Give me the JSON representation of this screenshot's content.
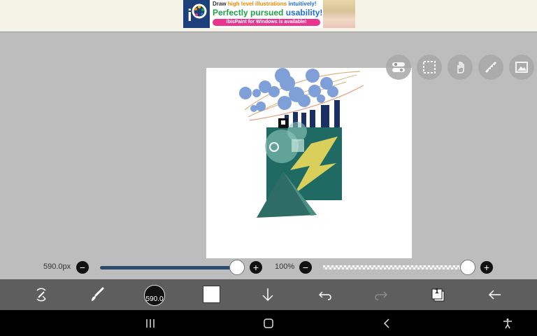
{
  "ad": {
    "line1_a": "Draw ",
    "line1_b": "high level illustrations",
    "line1_c": " intuitively!",
    "line2_a": "Perfectly pursued ",
    "line2_b": "usability!",
    "line3": "ibisPaint for Windows is available!",
    "logo_icon": "ibispaint-logo-icon",
    "colors": {
      "green": "#1ea24a",
      "blue": "#1f6fd6",
      "pink": "#e8358f",
      "orange": "#f08a00"
    }
  },
  "tools_top": [
    {
      "name": "toggle-panel-icon"
    },
    {
      "name": "selection-icon"
    },
    {
      "name": "hand-tool-icon"
    },
    {
      "name": "ruler-icon"
    },
    {
      "name": "image-icon"
    }
  ],
  "brush_size_slider": {
    "label": "590.0px",
    "value_fraction": 0.98
  },
  "opacity_slider": {
    "label": "100%",
    "value_fraction": 1.0
  },
  "toolbar": {
    "brush_size_label": "590.0",
    "layer_count": "1",
    "items": [
      "transform-tool-icon",
      "brush-icon",
      "brush-size",
      "color-swatch",
      "download-icon",
      "undo-icon",
      "redo-icon",
      "layers-icon",
      "back-icon"
    ],
    "current_color": "#ffffff"
  },
  "navbar": {
    "items": [
      "recent-apps-icon",
      "home-icon",
      "nav-back-icon",
      "accessibility-icon"
    ]
  },
  "colors": {
    "accent_dark_teal": "#1f6b63",
    "bubble_blue": "#7e9fd8",
    "navy": "#1a2f63",
    "lightning_yellow": "#d9cf5a",
    "slider_blue": "#2d4a6f",
    "toolbar_gray": "#5e5e5e"
  }
}
